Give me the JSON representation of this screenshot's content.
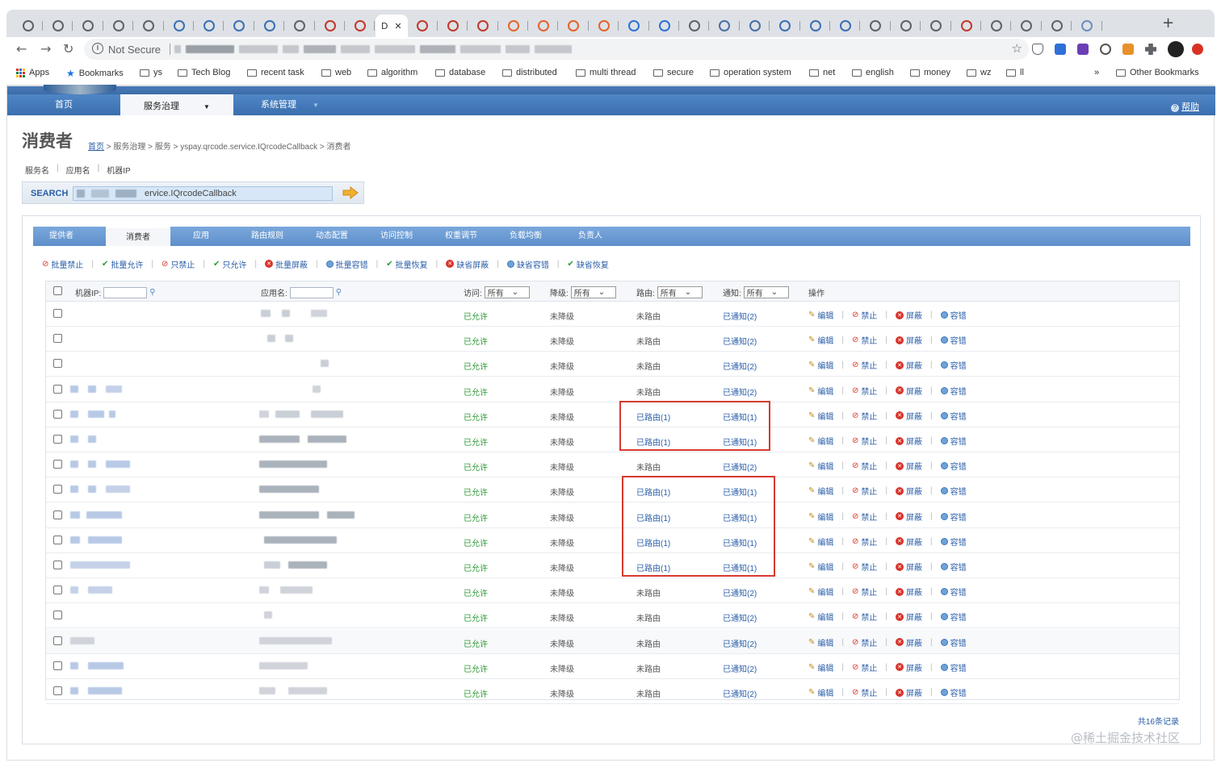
{
  "browser": {
    "active_tab_label": "D",
    "active_tab_close": "✕",
    "new_tab": "+",
    "nav": {
      "back": "←",
      "forward": "→",
      "reload": "↻"
    },
    "omnibox": {
      "info": "i",
      "security": "Not Secure",
      "star": "☆"
    },
    "bookmarks": [
      {
        "label": "Apps",
        "kind": "apps"
      },
      {
        "label": "Bookmarks",
        "kind": "star"
      },
      {
        "label": "ys",
        "kind": "folder"
      },
      {
        "label": "Tech Blog",
        "kind": "folder"
      },
      {
        "label": "recent task",
        "kind": "folder"
      },
      {
        "label": "web",
        "kind": "folder"
      },
      {
        "label": "algorithm",
        "kind": "folder"
      },
      {
        "label": "database",
        "kind": "folder"
      },
      {
        "label": "distributed",
        "kind": "folder"
      },
      {
        "label": "multi thread",
        "kind": "folder"
      },
      {
        "label": "secure",
        "kind": "folder"
      },
      {
        "label": "operation system",
        "kind": "folder"
      },
      {
        "label": "net",
        "kind": "folder"
      },
      {
        "label": "english",
        "kind": "folder"
      },
      {
        "label": "money",
        "kind": "folder"
      },
      {
        "label": "wz",
        "kind": "folder"
      },
      {
        "label": "ll",
        "kind": "folder"
      }
    ],
    "overflow": "»",
    "other_bookmarks": "Other Bookmarks",
    "colors": {
      "chrome_bg": "#dee1e6",
      "accent": "#1a73e8"
    }
  },
  "app": {
    "nav": {
      "home": "首页",
      "service_gov": "服务治理",
      "system": "系统管理",
      "help": "帮助"
    },
    "page_title": "消费者",
    "breadcrumb": {
      "home": "首页",
      "rest": " > 服务治理 > 服务 > yspay.qrcode.service.IQrcodeCallback > 消费者"
    },
    "search": {
      "tabs": [
        "服务名",
        "应用名",
        "机器IP"
      ],
      "label": "SEARCH",
      "value": "ervice.IQrcodeCallback"
    },
    "subtabs": [
      "提供者",
      "消费者",
      "应用",
      "路由规则",
      "动态配置",
      "访问控制",
      "权重调节",
      "负载均衡",
      "负责人"
    ],
    "actions": [
      {
        "label": "批量禁止",
        "icon": "ban-icon"
      },
      {
        "label": "批量允许",
        "icon": "check-icon"
      },
      {
        "label": "只禁止",
        "icon": "ban-icon"
      },
      {
        "label": "只允许",
        "icon": "check-icon"
      },
      {
        "label": "批量屏蔽",
        "icon": "block-icon"
      },
      {
        "label": "批量容错",
        "icon": "tolerance-icon"
      },
      {
        "label": "批量恢复",
        "icon": "check-icon"
      },
      {
        "label": "缺省屏蔽",
        "icon": "block-icon"
      },
      {
        "label": "缺省容错",
        "icon": "tolerance-icon"
      },
      {
        "label": "缺省恢复",
        "icon": "check-icon"
      }
    ],
    "table": {
      "headers": {
        "ip": "机器IP:",
        "app": "应用名:",
        "access": "访问:",
        "degrade": "降级:",
        "route": "路由:",
        "notify": "通知:",
        "ops": "操作",
        "all": "所有"
      },
      "row_ops": [
        "编辑",
        "禁止",
        "屏蔽",
        "容错"
      ],
      "rows": [
        {
          "access": "已允许",
          "degrade": "未降级",
          "route": "未路由",
          "notify": "已通知(2)"
        },
        {
          "access": "已允许",
          "degrade": "未降级",
          "route": "未路由",
          "notify": "已通知(2)"
        },
        {
          "access": "已允许",
          "degrade": "未降级",
          "route": "未路由",
          "notify": "已通知(2)"
        },
        {
          "access": "已允许",
          "degrade": "未降级",
          "route": "未路由",
          "notify": "已通知(2)"
        },
        {
          "access": "已允许",
          "degrade": "未降级",
          "route": "已路由(1)",
          "notify": "已通知(1)"
        },
        {
          "access": "已允许",
          "degrade": "未降级",
          "route": "已路由(1)",
          "notify": "已通知(1)"
        },
        {
          "access": "已允许",
          "degrade": "未降级",
          "route": "未路由",
          "notify": "已通知(2)"
        },
        {
          "access": "已允许",
          "degrade": "未降级",
          "route": "已路由(1)",
          "notify": "已通知(1)"
        },
        {
          "access": "已允许",
          "degrade": "未降级",
          "route": "已路由(1)",
          "notify": "已通知(1)"
        },
        {
          "access": "已允许",
          "degrade": "未降级",
          "route": "已路由(1)",
          "notify": "已通知(1)"
        },
        {
          "access": "已允许",
          "degrade": "未降级",
          "route": "已路由(1)",
          "notify": "已通知(1)"
        },
        {
          "access": "已允许",
          "degrade": "未降级",
          "route": "未路由",
          "notify": "已通知(2)"
        },
        {
          "access": "已允许",
          "degrade": "未降级",
          "route": "未路由",
          "notify": "已通知(2)"
        },
        {
          "access": "已允许",
          "degrade": "未降级",
          "route": "未路由",
          "notify": "已通知(2)"
        },
        {
          "access": "已允许",
          "degrade": "未降级",
          "route": "未路由",
          "notify": "已通知(2)"
        },
        {
          "access": "已允许",
          "degrade": "未降级",
          "route": "未路由",
          "notify": "已通知(2)"
        }
      ],
      "total": "共16条记录"
    },
    "colors": {
      "nav_blue": "#3b6fae",
      "link": "#2a5ea8",
      "allowed": "#2e9a35",
      "highlight": "#d63a2e"
    }
  },
  "watermark": "@稀土掘金技术社区"
}
